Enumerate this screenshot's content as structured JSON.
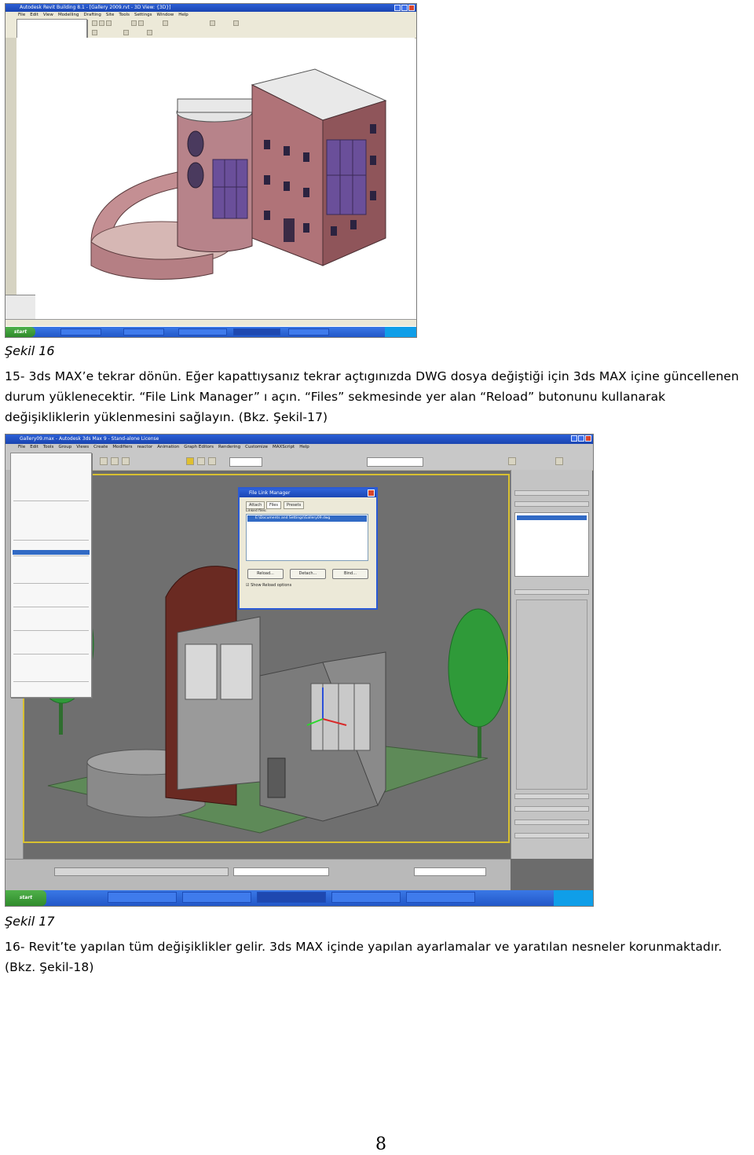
{
  "figure16": {
    "window_title": "Autodesk Revit Building 8.1 - [Gallery 2009.rvt - 3D View: {3D}]",
    "menus": [
      "File",
      "Edit",
      "View",
      "Modelling",
      "Drafting",
      "Site",
      "Tools",
      "Settings",
      "Window",
      "Help"
    ],
    "taskbar": {
      "start": "start"
    },
    "caption": "Şekil 16"
  },
  "paragraph15": {
    "line1": "15- 3ds MAX’e tekrar dönün. Eğer kapattıysanız tekrar açtıgınızda DWG dosya değiştiği için 3ds MAX içine güncellenen",
    "line2": "durum yüklenecektir. “File Link Manager” ı açın. “Files” sekmesinde yer alan “Reload” butonunu kullanarak",
    "line3": "değişikliklerin yüklenmesini sağlayın. (Bkz. Şekil-17)"
  },
  "figure17": {
    "window_title": "Gallery09.max - Autodesk 3ds Max 9 - Stand-alone License",
    "menus": [
      "File",
      "Edit",
      "Tools",
      "Group",
      "Views",
      "Create",
      "Modifiers",
      "reactor",
      "Animation",
      "Graph Editors",
      "Rendering",
      "Customize",
      "MAXScript",
      "Help"
    ],
    "dialog": {
      "title": "File Link Manager",
      "tabs": [
        "Attach",
        "Files",
        "Presets"
      ],
      "list_label": "Linked files:",
      "selected_file": "E:\\Documents and Settings\\Gallery09.dwg",
      "buttons": [
        "Reload...",
        "Detach...",
        "Bind..."
      ],
      "checkbox": "Show Reload options"
    },
    "taskbar": {
      "start": "start"
    },
    "caption": "Şekil 17"
  },
  "paragraph16": {
    "line1": "16- Revit’te yapılan tüm değişiklikler gelir. 3ds MAX içinde yapılan ayarlamalar ve yaratılan nesneler korunmaktadır.",
    "line2": "(Bkz. Şekil-18)"
  },
  "page_number": "8"
}
